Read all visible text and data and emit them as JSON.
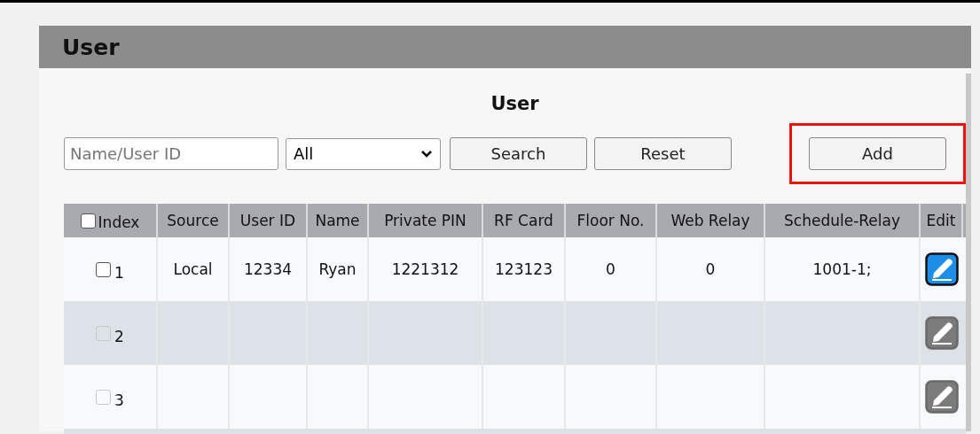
{
  "panel": {
    "title": "User"
  },
  "section": {
    "title": "User"
  },
  "toolbar": {
    "search_field": {
      "placeholder": "Name/User ID"
    },
    "filter": {
      "value": "All"
    },
    "buttons": [
      {
        "label": "Search",
        "highlighted": false
      },
      {
        "label": "Reset",
        "highlighted": false
      },
      {
        "label": "Add",
        "highlighted": true
      }
    ]
  },
  "table": {
    "select_all": {
      "checked": false
    },
    "columns": [
      "Index",
      "Source",
      "User ID",
      "Name",
      "Private PIN",
      "RF Card",
      "Floor No.",
      "Web Relay",
      "Schedule-Relay",
      "Edit"
    ],
    "rows": [
      {
        "checked": false,
        "disabled": false,
        "cells": [
          "1",
          "Local",
          "12334",
          "Ryan",
          "1221312",
          "123123",
          "0",
          "0",
          "1001-1;"
        ]
      },
      {
        "checked": false,
        "disabled": true,
        "cells": [
          "2"
        ]
      },
      {
        "checked": false,
        "disabled": true,
        "cells": [
          "3"
        ]
      }
    ]
  }
}
